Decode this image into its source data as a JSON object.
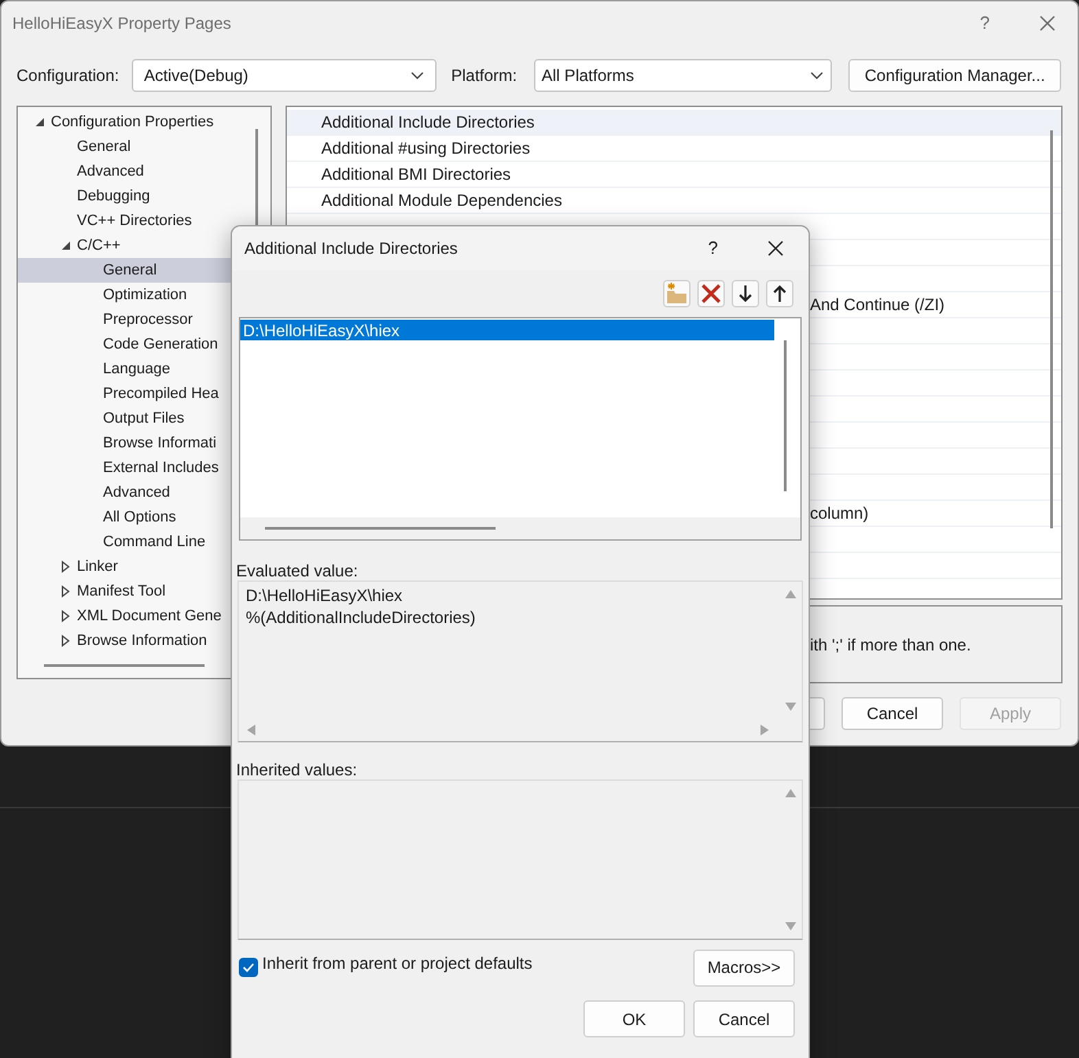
{
  "window": {
    "title": "HelloHiEasyX Property Pages",
    "help": "?"
  },
  "configuration": {
    "label": "Configuration:",
    "value": "Active(Debug)"
  },
  "platform": {
    "label": "Platform:",
    "value": "All Platforms"
  },
  "manager_button": "Configuration Manager...",
  "tree": [
    {
      "label": "Configuration Properties",
      "expanded": true,
      "selected": false,
      "children": [
        {
          "label": "General",
          "selected": false
        },
        {
          "label": "Advanced",
          "selected": false
        },
        {
          "label": "Debugging",
          "selected": false
        },
        {
          "label": "VC++ Directories",
          "selected": false
        },
        {
          "label": "C/C++",
          "expanded": true,
          "selected": false,
          "children": [
            {
              "label": "General",
              "selected": true
            },
            {
              "label": "Optimization",
              "selected": false
            },
            {
              "label": "Preprocessor",
              "selected": false
            },
            {
              "label": "Code Generation",
              "selected": false
            },
            {
              "label": "Language",
              "selected": false
            },
            {
              "label": "Precompiled Hea",
              "selected": false
            },
            {
              "label": "Output Files",
              "selected": false
            },
            {
              "label": "Browse Informati",
              "selected": false
            },
            {
              "label": "External Includes",
              "selected": false
            },
            {
              "label": "Advanced",
              "selected": false
            },
            {
              "label": "All Options",
              "selected": false
            },
            {
              "label": "Command Line",
              "selected": false
            }
          ]
        },
        {
          "label": "Linker",
          "expanded": false,
          "selected": false
        },
        {
          "label": "Manifest Tool",
          "expanded": false,
          "selected": false
        },
        {
          "label": "XML Document Gene",
          "expanded": false,
          "selected": false
        },
        {
          "label": "Browse Information",
          "expanded": false,
          "selected": false
        }
      ]
    }
  ],
  "properties": [
    {
      "name": "Additional Include Directories",
      "selected": true
    },
    {
      "name": "Additional #using Directories",
      "selected": false
    },
    {
      "name": "Additional BMI Directories",
      "selected": false
    },
    {
      "name": "Additional Module Dependencies",
      "selected": false
    },
    {
      "selected": false
    },
    {
      "selected": false
    },
    {
      "selected": false
    },
    {
      "value": "And Continue (/ZI)",
      "selected": false
    },
    {
      "selected": false
    },
    {
      "selected": false
    },
    {
      "selected": false
    },
    {
      "selected": false
    },
    {
      "selected": false
    },
    {
      "selected": false
    },
    {
      "selected": false
    },
    {
      "value": "column)",
      "selected": false
    },
    {
      "selected": false
    },
    {
      "selected": false
    }
  ],
  "description": "ith ';' if more than one.",
  "buttons": [
    {
      "label": "Cancel",
      "disabled": false
    },
    {
      "label": "Apply",
      "disabled": true
    }
  ],
  "dialog": {
    "title": "Additional Include Directories",
    "help": "?",
    "tools": [
      {
        "kind": "new-folder"
      },
      {
        "kind": "delete"
      },
      {
        "kind": "down"
      },
      {
        "kind": "up"
      }
    ],
    "items": [
      {
        "text": "D:\\HelloHiEasyX\\hiex",
        "selected": true
      }
    ],
    "evaluated_label": "Evaluated value:",
    "evaluated_lines": [
      "D:\\HelloHiEasyX\\hiex",
      "%(AdditionalIncludeDirectories)"
    ],
    "inherited_label": "Inherited values:",
    "inherit": {
      "label": "Inherit from parent or project defaults",
      "checked": true
    },
    "macros_button": "Macros>>",
    "buttons": [
      "OK",
      "Cancel"
    ]
  }
}
